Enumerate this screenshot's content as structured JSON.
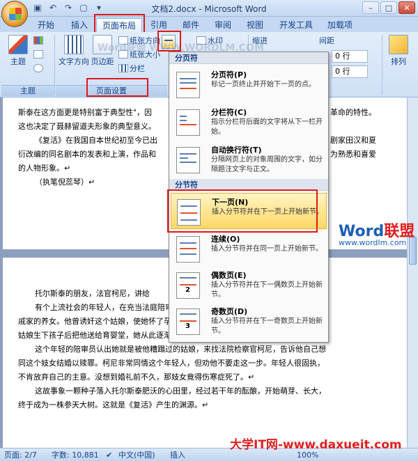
{
  "window": {
    "title": "文档2.docx - Microsoft Word"
  },
  "tabs": [
    "开始",
    "插入",
    "页面布局",
    "引用",
    "邮件",
    "审阅",
    "视图",
    "开发工具",
    "加载项"
  ],
  "ribbon": {
    "theme_group": {
      "label": "主题",
      "theme_button": "主题"
    },
    "page_setup_group": {
      "label": "页面设置",
      "text_direction": "文字方向",
      "margins": "页边距",
      "orientation": "纸张方向",
      "size": "纸张大小",
      "columns": "分栏"
    },
    "page_background": {
      "watermark": "水印"
    },
    "paragraph": {
      "indent": "缩进",
      "spacing": "间距",
      "before": "0 行",
      "after": "0 行"
    },
    "arrange": {
      "label": "排列"
    },
    "watermark_text": "Word联盟 WWW.WORDLM.COM"
  },
  "dropdown": {
    "page_breaks_header": "分页符",
    "section_breaks_header": "分节符",
    "items": [
      {
        "title": "分页符(P)",
        "desc": "标记一页终止并开始下一页的点。"
      },
      {
        "title": "分栏符(C)",
        "desc": "指示分栏符后面的文字将从下一栏开始。"
      },
      {
        "title": "自动换行符(T)",
        "desc": "分隔网页上的对象周围的文字，如分隔题注文字与正文。"
      },
      {
        "title": "下一页(N)",
        "desc": "插入分节符并在下一页上开始新节。"
      },
      {
        "title": "连续(O)",
        "desc": "插入分节符并在同一页上开始新节。"
      },
      {
        "title": "偶数页(E)",
        "desc": "插入分节符并在下一偶数页上开始新节。"
      },
      {
        "title": "奇数页(D)",
        "desc": "插入分节符并在下一奇数页上开始新节。"
      }
    ]
  },
  "document": {
    "page1_lines": [
      "斯泰在这方面更是特别富于典型性\"，因",
      "这也决定了聂赫留道夫形象的典型意义。",
      "《复活》在我国自本世纪初至今已出",
      "衍改编的同名剧本的发表和上演，作品和",
      "的人物形象。↵",
      "（执笔倪蕊琴）↵"
    ],
    "page1_right_lines": [
      "革命的特性。",
      "剧家田汉和夏",
      "为熟悉和喜爱"
    ],
    "page2_lines": [
      "托尔斯泰的朋友，法官柯尼，讲给",
      "有个上流社会的年轻人，在充当法庭陪审员时，认出一个被控盗窃罪的妓女就是他亲",
      "戚家的养女。他曾诱奸这个姑娘，使她怀了孕。收养她的女主人知道这事后，把她赶出家门。",
      "姑娘生下孩子后把他送给育婴堂，她从此逐渐堕落，最后落入下等妓院，当了妓女。↵",
      "这个年轻的陪审员认出她就是被他糟蹋过的姑娘，来找法院检察官柯尼，告诉他自己想",
      "同这个妓女结婚以赎罪。柯尼非常同情这个年轻人，但劝他不要走这一步。年轻人很固执，",
      "不肯放弃自己的主意。没想到婚礼前不久，那妓女竟得伤寒症死了。↵",
      "这故事象一颗种子落入托尔斯泰肥沃的心田里，经过若干年的酝酿，开始萌芽、长大，",
      "终于成为一株参天大树。这就是《复活》产生的渊源。↵"
    ]
  },
  "status": {
    "page": "页面: 2/7",
    "words": "字数: 10,881",
    "language": "中文(中国)",
    "insert": "插入",
    "zoom": "100%"
  },
  "branding": {
    "wordlm_title_a": "Word",
    "wordlm_title_b": "联盟",
    "wordlm_url": "www.wordlm.com",
    "daxueit": "大学IT网-www.daxueit.com"
  },
  "colors": {
    "highlight_red": "#e01818",
    "ribbon_text": "#15428b"
  }
}
